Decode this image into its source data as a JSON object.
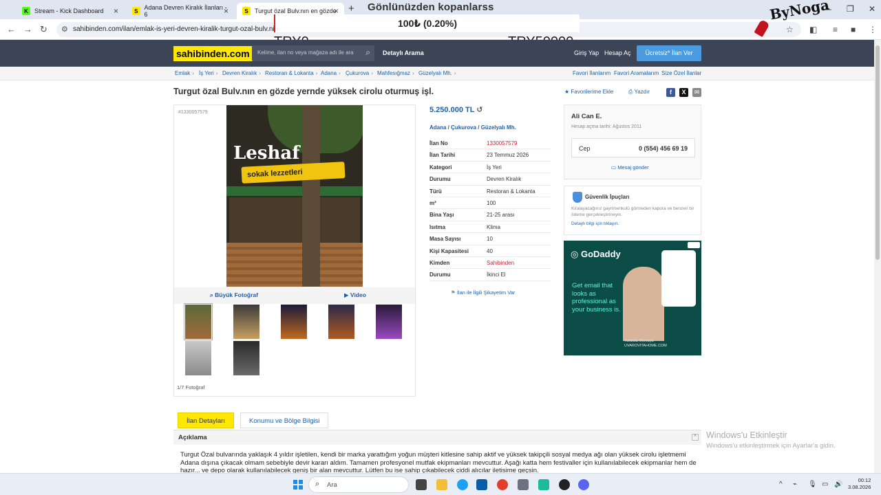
{
  "browser": {
    "tabs": [
      {
        "label": "Stream - Kick Dashboard"
      },
      {
        "label": "Adana Devren Kiralık İlanları - 6"
      },
      {
        "label": "Turgut özal Bulv.nın en gözde"
      }
    ],
    "url": "sahibinden.com/ilan/emlak-is-yeri-devren-kiralik-turgut-ozal-bulv.nin-"
  },
  "overlay": {
    "title": "Gönlünüzden kopanlarss",
    "progress_text": "100₺ (0.20%)",
    "progress_fraction": 0.002,
    "min_label": "TRY0",
    "max_label": "TRY50000",
    "brand": "ByNoga"
  },
  "site": {
    "logo": "sahibinden.com",
    "search_placeholder": "Kelime, ilan no veya mağaza adı ile ara",
    "detailed_search": "Detaylı Arama",
    "login": "Giriş Yap",
    "register": "Hesap Aç",
    "post_ad": "Ücretsiz* İlan Ver"
  },
  "breadcrumb": [
    "Emlak",
    "İş Yeri",
    "Devren Kiralık",
    "Restoran & Lokanta",
    "Adana",
    "Çukurova",
    "Mahfesığmaz",
    "Güzelyalı Mh."
  ],
  "breadcrumb_right": [
    "Favori İlanlarım",
    "Favori Aramalarım",
    "Size Özel İlanlar"
  ],
  "listing": {
    "title": "Turgut özal Bulv.nın en gözde yernde yüksek cirolu oturmuş işl.",
    "add_favorite": "Favorilerime Ekle",
    "print": "Yazdır",
    "id_small": "#1330057579",
    "photo_sign": "Leshaf",
    "photo_sign2": "sokak lezzetleri",
    "big_photo": "Büyük Fotoğraf",
    "video": "Video",
    "photo_count": "1/7 Fotoğraf",
    "price": "5.250.000 TL",
    "location": [
      "Adana",
      "Çukurova",
      "Güzelyalı Mh."
    ],
    "details": [
      {
        "k": "İlan No",
        "v": "1330057579"
      },
      {
        "k": "İlan Tarihi",
        "v": "23 Temmuz 2026"
      },
      {
        "k": "Kategori",
        "v": "İş Yeri"
      },
      {
        "k": "Durumu",
        "v": "Devren Kiralık"
      },
      {
        "k": "Türü",
        "v": "Restoran & Lokanta"
      },
      {
        "k": "m²",
        "v": "100"
      },
      {
        "k": "Bina Yaşı",
        "v": "21-25 arası"
      },
      {
        "k": "Isıtma",
        "v": "Klima"
      },
      {
        "k": "Masa Sayısı",
        "v": "10"
      },
      {
        "k": "Kişi Kapasitesi",
        "v": "40"
      },
      {
        "k": "Kimden",
        "v": "Sahibinden"
      },
      {
        "k": "Durumu",
        "v": "İkinci El"
      }
    ],
    "complaint": "İlan ile İlgili Şikayetim Var"
  },
  "seller": {
    "name": "Ali Can E.",
    "since": "Hesap açma tarihi: Ağustos 2011",
    "phone_label": "Cep",
    "phone": "0 (554) 456 69 19",
    "message": "Mesaj gönder"
  },
  "security": {
    "title": "Güvenlik İpuçları",
    "text": "Kiralayacağınız gayrimenkulü görmeden kapora ve benzeri bir ödeme gerçekleştirmeyin.",
    "link_prefix": "Detaylı bilgi için",
    "link": "tıklayın."
  },
  "ad": {
    "brand": "GoDaddy",
    "text": "Get email that looks as professional as your business is.",
    "footer": "Yuribdia Montuya\nUVAROVITAHOME.COM"
  },
  "tabs": {
    "details": "İlan Detayları",
    "location": "Konumu ve Bölge Bilgisi"
  },
  "description": {
    "heading": "Açıklama",
    "text": "Turgut Özal bulvarında yaklaşık 4 yıldır işletilen, kendi bir marka yarattığım yoğun müşteri kitlesine sahip aktif ve yüksek takipçili sosyal medya ağı olan yüksek cirolu işletmemi Adana dışına çıkacak olmam sebebiyle devir kararı aldım. Tamamen profesyonel mutfak ekipmanları mevcuttur. Aşağı katta hem festivaller için kullanılabilecek ekipmanlar hem de hazır... ve depo olarak kullanılabilecek geniş bir alan mevcuttur. Lütfen bu ise sahip çıkabilecek ciddi alıcılar iletisime geçsin."
  },
  "windows": {
    "activate1": "Windows'u Etkinleştir",
    "activate2": "Windows'u etkinleştirmek için Ayarlar'a gidin.",
    "search": "Ara",
    "time": "00:12",
    "date": "3.08.2026"
  },
  "colors": {
    "brand_yellow": "#ffe800",
    "header": "#3b4556",
    "link": "#1f5fa3",
    "accent_red": "#d0202c",
    "cta_blue": "#4b9be1"
  }
}
